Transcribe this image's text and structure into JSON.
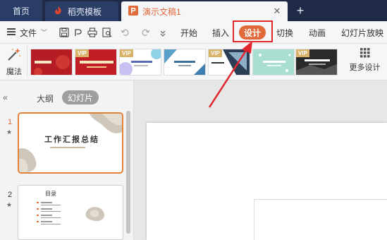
{
  "tabs": {
    "home": "首页",
    "template": "稻壳模板",
    "document": "演示文稿1"
  },
  "menu": {
    "file": "文件",
    "items": [
      "开始",
      "插入",
      "设计",
      "切换",
      "动画",
      "幻灯片放映"
    ]
  },
  "design_toolbar": {
    "magic": "魔法",
    "vip": "VIP",
    "more_design": "更多设计"
  },
  "left_panel": {
    "outline_tab": "大纲",
    "slides_tab": "幻灯片",
    "slides": [
      {
        "number": "1",
        "title": "工作汇报总结"
      },
      {
        "number": "2",
        "title": "目录"
      }
    ]
  },
  "colors": {
    "accent": "#e06a3a",
    "tabbar": "#1e2a46",
    "highlight": "#e0262c"
  }
}
